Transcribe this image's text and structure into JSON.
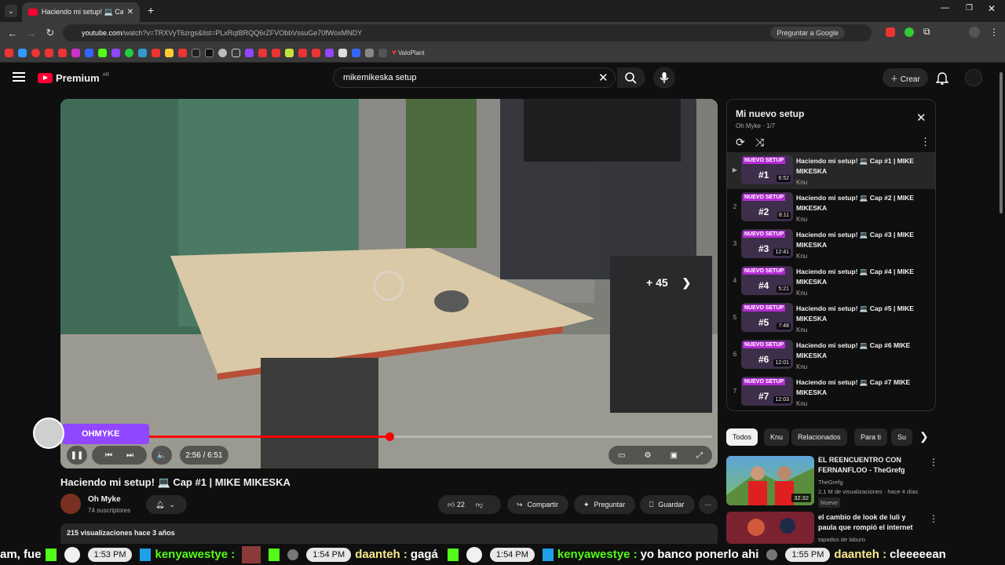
{
  "browser": {
    "tab_title": "Haciendo mi setup! 💻 Cap",
    "url_domain": "youtube.com",
    "url_path": "/watch?v=TRXVyT6zrgs&list=PLxRqtBRQQ6rZFVObbVssuGe70fWoxMNDY",
    "gemini_label": "Preguntar a Google",
    "bookmark_label": "ValoPlant"
  },
  "header": {
    "logo_text": "Premium",
    "logo_cc": "AR",
    "search_value": "mikemikeska setup",
    "crear_label": "Crear"
  },
  "player": {
    "skip_label": "+ 45",
    "time_label": "2:56 / 6:51",
    "progress_fraction": 0.428,
    "overlay_name": "OHMYKE"
  },
  "video": {
    "title": "Haciendo mi setup! 💻 Cap #1 | MIKE MIKESKA",
    "channel": "Oh Myke",
    "subs": "74 suscriptores",
    "likes": "22",
    "share": "Compartir",
    "ask": "Preguntar",
    "save": "Guardar",
    "views": "215 visualizaciones  hace 3 años"
  },
  "playlist": {
    "title": "Mi nuevo setup",
    "sub": "Oh Myke · 1/7",
    "items": [
      {
        "idx": "▶",
        "num": "#1",
        "dur": "6:52",
        "title": "Haciendo mi setup! 💻 Cap #1 | MIKE MIKESKA",
        "channel": "Knu"
      },
      {
        "idx": "2",
        "num": "#2",
        "dur": "8:11",
        "title": "Haciendo mi setup! 💻 Cap #2 | MIKE MIKESKA",
        "channel": "Knu"
      },
      {
        "idx": "3",
        "num": "#3",
        "dur": "12:41",
        "title": "Haciendo mi setup! 💻 Cap #3 | MIKE MIKESKA",
        "channel": "Knu"
      },
      {
        "idx": "4",
        "num": "#4",
        "dur": "5:21",
        "title": "Haciendo mi setup! 💻 Cap #4 | MIKE MIKESKA",
        "channel": "Knu"
      },
      {
        "idx": "5",
        "num": "#5",
        "dur": "7:48",
        "title": "Haciendo mi setup! 💻 Cap #5 | MIKE MIKESKA",
        "channel": "Knu"
      },
      {
        "idx": "6",
        "num": "#6",
        "dur": "12:01",
        "title": "Haciendo mi setup! 💻 Cap #6 MIKE MIKESKA",
        "channel": "Knu"
      },
      {
        "idx": "7",
        "num": "#7",
        "dur": "12:03",
        "title": "Haciendo mi setup! 💻 Cap #7 MIKE MIKESKA",
        "channel": "Knu"
      }
    ],
    "nuevo_label": "NUEVO SETUP"
  },
  "chips": [
    "Todos",
    "Knu",
    "Relacionados",
    "Para ti",
    "Su"
  ],
  "recommended": [
    {
      "title": "EL REENCUENTRO CON FERNANFLOO - TheGrefg",
      "channel": "TheGrefg",
      "meta": "2,1 M de visualizaciones · hace 4 días",
      "badge": "Nuevo",
      "dur": "32:32"
    },
    {
      "title": "el cambio de look de luli y paula que rompió el internet",
      "channel": "tapados de laburo",
      "meta": "",
      "badge": "",
      "dur": ""
    }
  ],
  "ticker": {
    "frag": "am, fue",
    "t1": "1:53 PM",
    "u1": "kenyawestye :",
    "t2": "1:54 PM",
    "u2": "daanteh :",
    "m2": "gagá",
    "t3": "1:54 PM",
    "u3": "kenyawestye :",
    "m3": "yo banco ponerlo ahi",
    "t4": "1:55 PM",
    "u4": "daanteh :",
    "m4": "cleeeeean"
  },
  "colors": {
    "accent": "#ff0000",
    "kick_green": "#53fc18",
    "twitch_purple": "#9146ff"
  }
}
